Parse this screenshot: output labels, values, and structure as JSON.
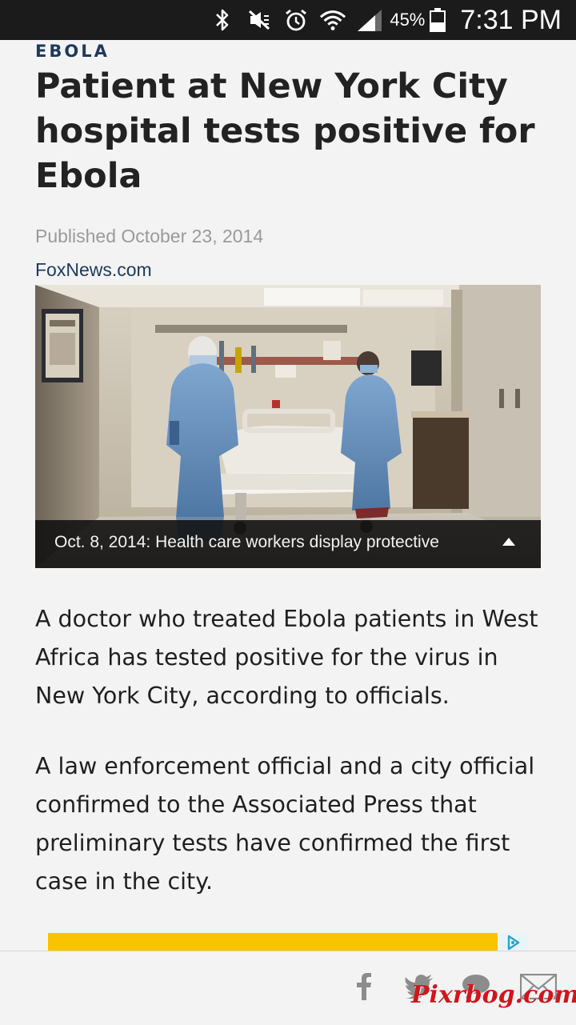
{
  "status_bar": {
    "icons": [
      "bluetooth-icon",
      "mute-icon",
      "alarm-icon",
      "wifi-icon",
      "signal-icon"
    ],
    "battery_percent": "45%",
    "battery_level": 0.45,
    "time": "7:31 PM"
  },
  "article": {
    "kicker": "EBOLA",
    "headline": "Patient at New York City hospital tests positive for Ebola",
    "published": "Published October 23, 2014",
    "source": "FoxNews.com",
    "image": {
      "caption": "Oct. 8, 2014: Health care workers display protective",
      "caption_toggle_icon": "caret-up-icon"
    },
    "paragraphs": [
      "A doctor who treated Ebola patients in West Africa has tested positive for the virus in New York City, according to officials.",
      "A law enforcement official and a city official confirmed to the Associated Press that preliminary tests have confirmed the first case in the city."
    ]
  },
  "ad": {
    "background": "#f9c300",
    "badge_icon": "adchoices-icon"
  },
  "share_bar": {
    "buttons": [
      "facebook-icon",
      "twitter-icon",
      "comment-icon",
      "email-icon"
    ],
    "icon_color": "#8c8c8c"
  },
  "watermark": "Pixrbog.com",
  "colors": {
    "kicker": "#1e3a5c",
    "source_link": "#1e3a5c",
    "published": "#9a9a9a",
    "background": "#f3f3f3"
  }
}
